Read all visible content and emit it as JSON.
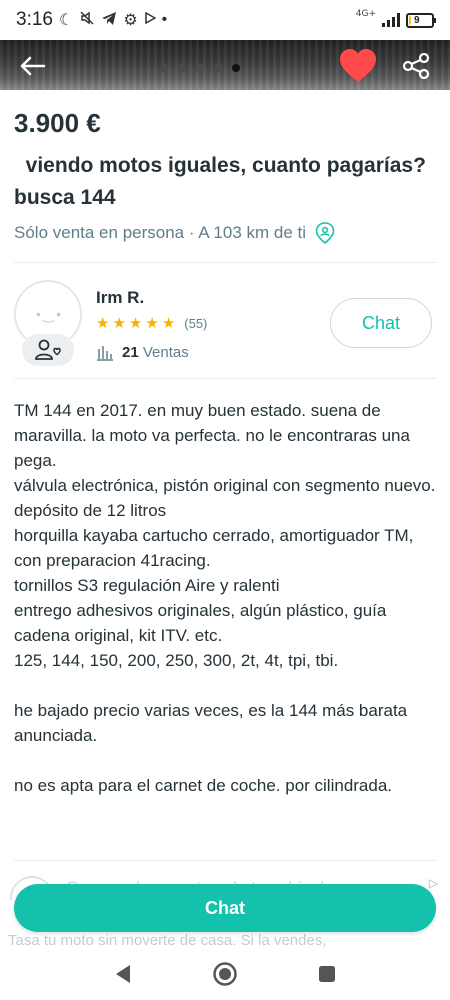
{
  "status_bar": {
    "time": "3:16",
    "network": "4G+",
    "battery": "9",
    "battery_level": 0.09
  },
  "header": {
    "photo_count": 5,
    "active_photo_index": 4
  },
  "listing": {
    "price": "3.900 €",
    "title": "  viendo motos iguales, cuanto pagarías? busca 144",
    "shipping_text": "Sólo venta en persona · A 103 km de ti"
  },
  "seller": {
    "name": "Irm R.",
    "rating": 5,
    "review_count": "(55)",
    "sales_count": "21",
    "sales_label": "Ventas",
    "chat_label": "Chat"
  },
  "description": "TM 144 en 2017. en muy buen estado. suena de maravilla. la moto va perfecta. no le encontraras una pega.\nválvula electrónica, pistón original con segmento nuevo. depósito de 12 litros\nhorquilla kayaba cartucho cerrado, amortiguador TM, con preparacion 41racing.\ntornillos S3 regulación Aire y ralenti\nentrego adhesivos originales, algún plástico, guía cadena original, kit ITV. etc.\n125, 144, 150, 200, 250, 300, 2t, 4t, tpi, tbi.\n\nhe bajado precio varias veces, es la 144 más barata anunciada.\n\nno es apta para el carnet de coche. por cilindrada.",
  "bottom": {
    "peek_text": "Comprueba cuanto vale tu vehículo",
    "peek_subtext": "Tasa tu moto sin moverte de casa. Si la vendes,",
    "chat_button": "Chat"
  },
  "colors": {
    "accent": "#13c1ac",
    "heart": "#ff4b4b",
    "text": "#253238",
    "secondary_text": "#607d8b",
    "star": "#f5b301"
  },
  "icons": {
    "back": "arrow-left-icon",
    "favorite": "heart-icon",
    "share": "share-icon",
    "location": "location-person-icon",
    "badge": "users-icon",
    "sales": "bar-chart-icon",
    "nav_back": "triangle-back-icon",
    "nav_home": "circle-home-icon",
    "nav_recents": "square-recents-icon"
  }
}
